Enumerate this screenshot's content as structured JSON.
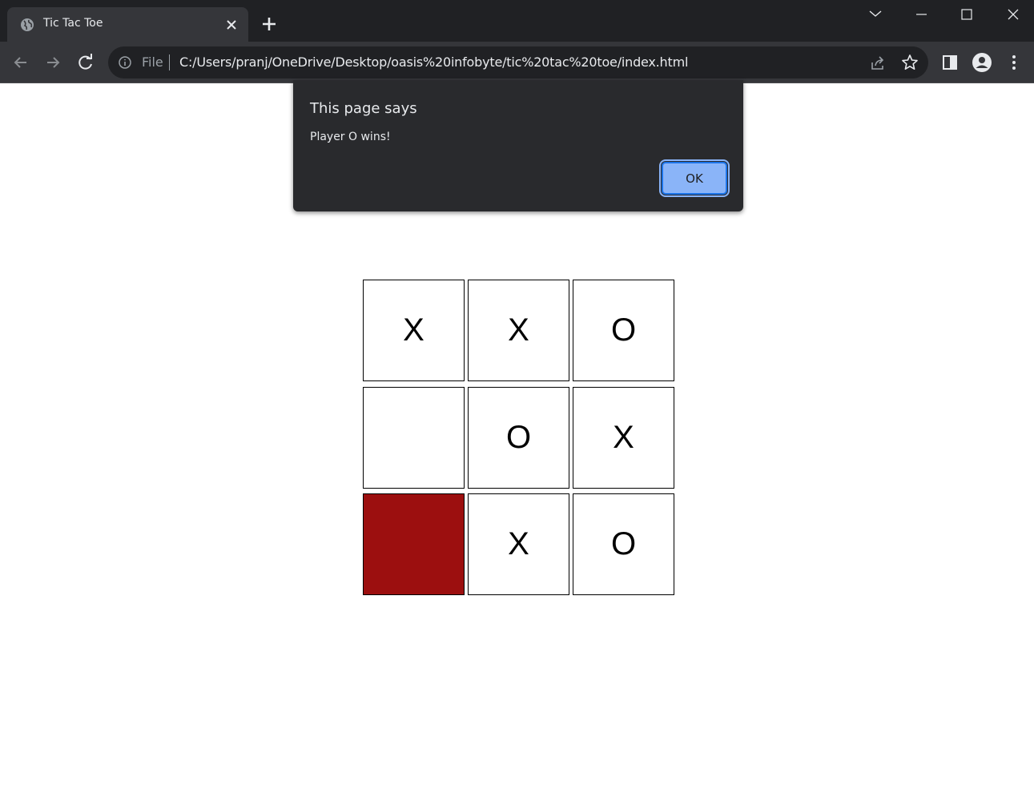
{
  "tab": {
    "title": "Tic Tac Toe"
  },
  "omnibox": {
    "scheme": "File",
    "url": "C:/Users/pranj/OneDrive/Desktop/oasis%20infobyte/tic%20tac%20toe/index.html"
  },
  "dialog": {
    "title": "This page says",
    "message": "Player O wins!",
    "ok_label": "OK"
  },
  "board": {
    "cells": [
      "X",
      "X",
      "O",
      "",
      "O",
      "X",
      "",
      "X",
      "O"
    ],
    "highlight_cell": 6,
    "highlight_color": "#9c0f0f"
  },
  "colors": {
    "chrome_dark": "#202124",
    "toolbar": "#35363a",
    "dialog_bg": "#292a2d",
    "ok_button": "#8ab4f8"
  },
  "icons": [
    "globe-icon",
    "close-icon",
    "plus-icon",
    "chevron-down-icon",
    "minimize-icon",
    "maximize-icon",
    "close-window-icon",
    "back-arrow-icon",
    "forward-arrow-icon",
    "reload-icon",
    "info-icon",
    "share-icon",
    "star-icon",
    "side-panel-icon",
    "profile-icon",
    "more-vert-icon"
  ]
}
